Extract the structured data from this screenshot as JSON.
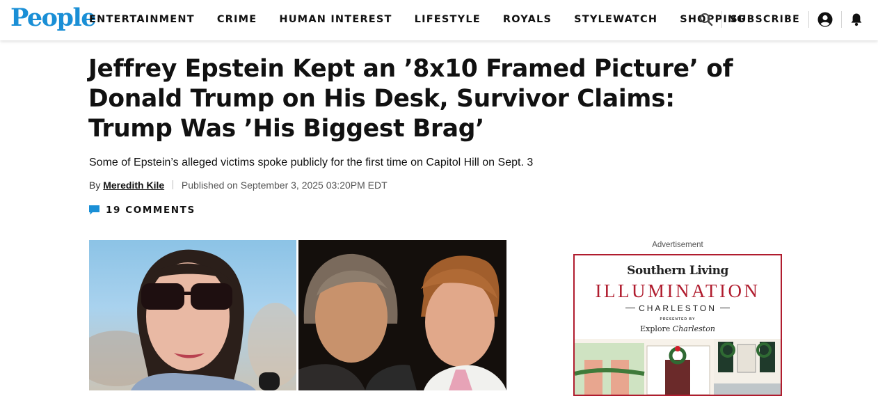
{
  "header": {
    "logo": "People",
    "nav": [
      "ENTERTAINMENT",
      "CRIME",
      "HUMAN INTEREST",
      "LIFESTYLE",
      "ROYALS",
      "STYLEWATCH",
      "SHOPPING"
    ],
    "subscribe": "SUBSCRIBE",
    "icons": [
      "search-icon",
      "account-icon",
      "bell-icon"
    ]
  },
  "article": {
    "headline": "Jeffrey Epstein Kept an ’8x10 Framed Picture’ of Donald Trump on His Desk, Survivor Claims: Trump Was ’His Biggest Brag’",
    "dek": "Some of Epstein’s alleged victims spoke publicly for the first time on Capitol Hill on Sept. 3",
    "byline_prefix": "By",
    "author": "Meredith Kile",
    "published": "Published on September 3, 2025 03:20PM EDT",
    "comments": "19 COMMENTS"
  },
  "ad": {
    "label": "Advertisement",
    "brand": "Southern Living",
    "event": "ILLUMINATION",
    "city": "CHARLESTON",
    "presented": "PRESENTED BY",
    "sponsor_a": "Explore",
    "sponsor_b": "Charleston"
  },
  "colors": {
    "logo_blue": "#1a8fd6",
    "comment_icon_blue": "#1a8fd6",
    "ad_red": "#b01c2e"
  }
}
